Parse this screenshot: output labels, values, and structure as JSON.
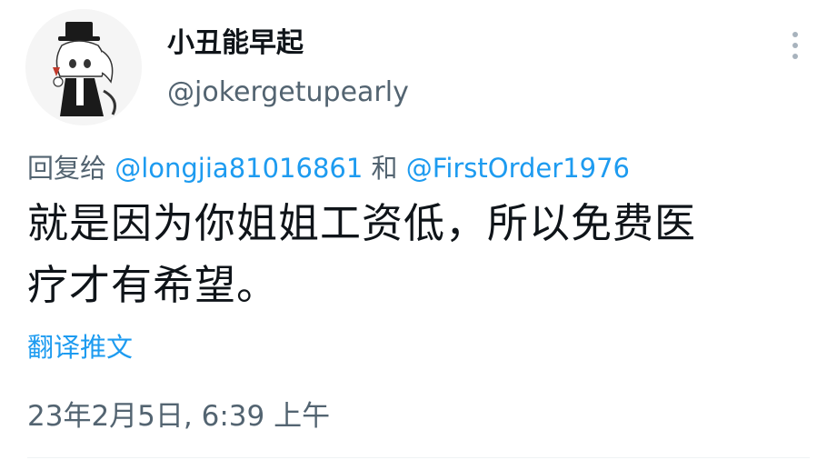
{
  "user": {
    "display_name": "小丑能早起",
    "handle": "@jokergetupearly",
    "avatar_icon": "chibi-character-top-hat-avatar"
  },
  "reply": {
    "prefix": "回复给 ",
    "mention_1": "@longjia81016861",
    "conjunction": " 和 ",
    "mention_2": "@FirstOrder1976"
  },
  "tweet": {
    "text_line_1": "就是因为你姐姐工资低，所以免费医",
    "text_line_2": "疗才有希望。",
    "translate_label": "翻译推文",
    "timestamp": "23年2月5日, 6:39 上午"
  },
  "colors": {
    "link": "#1d9bf0",
    "secondary_text": "#536471",
    "primary_text": "#0f1419"
  },
  "icons": {
    "more": "more-vertical-icon"
  }
}
